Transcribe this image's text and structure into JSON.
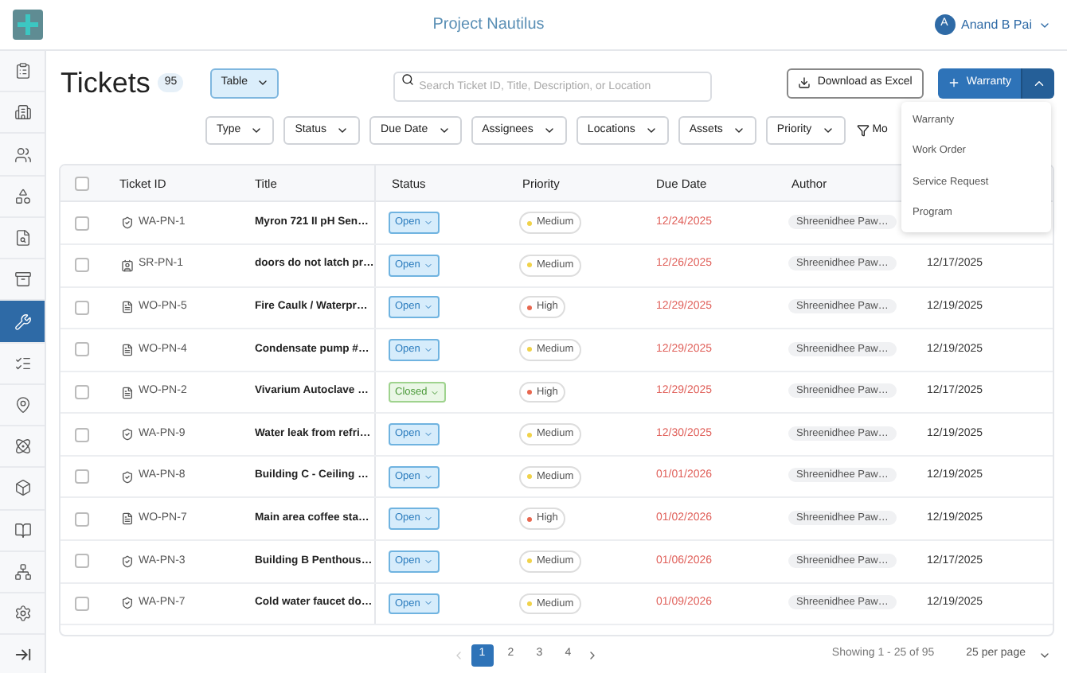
{
  "header": {
    "title": "Project Nautilus",
    "user": {
      "initial": "A",
      "name": "Anand B Pai"
    }
  },
  "sidebar": {
    "items": [
      {
        "selected": false
      },
      {
        "selected": false
      },
      {
        "selected": false
      },
      {
        "selected": false
      },
      {
        "selected": false
      },
      {
        "selected": false
      },
      {
        "selected": true
      },
      {
        "selected": false
      },
      {
        "selected": false
      },
      {
        "selected": false
      },
      {
        "selected": false
      },
      {
        "selected": false
      },
      {
        "selected": false
      },
      {
        "selected": false
      }
    ]
  },
  "page": {
    "title": "Tickets",
    "count": "95",
    "view": "Table",
    "search": {
      "placeholder": "Search Ticket ID, Title, Description, or Location"
    },
    "download": "Download as Excel",
    "create": "Warranty",
    "menu_open": true
  },
  "create_menu": [
    "Warranty",
    "Work Order",
    "Service Request",
    "Program"
  ],
  "filters": [
    "Type",
    "Status",
    "Due Date",
    "Assignees",
    "Locations",
    "Assets",
    "Priority"
  ],
  "more_filters": "Mo",
  "table": {
    "all_selected": false,
    "columns": [
      "Ticket ID",
      "Title",
      "Status",
      "Priority",
      "Due Date",
      "Author"
    ],
    "rows": [
      {
        "kind": "warranty",
        "id": "WA-PN-1",
        "title": "Myron 721 II pH Sen…",
        "status": "Open",
        "closed": false,
        "priority": "Medium",
        "color": "#f0d24a",
        "due": "12/24/2025",
        "author": "Shreenidhee Paw…",
        "checked": false
      },
      {
        "kind": "service",
        "id": "SR-PN-1",
        "title": "doors do not latch pr…",
        "status": "Open",
        "closed": false,
        "priority": "Medium",
        "color": "#f0d24a",
        "due": "12/26/2025",
        "author": "Shreenidhee Paw…",
        "created": "12/17/2025",
        "checked": false
      },
      {
        "kind": "work",
        "id": "WO-PN-5",
        "title": "Fire Caulk / Waterpr…",
        "status": "Open",
        "closed": false,
        "priority": "High",
        "color": "#e8674f",
        "due": "12/29/2025",
        "author": "Shreenidhee Paw…",
        "created": "12/19/2025",
        "checked": false
      },
      {
        "kind": "work",
        "id": "WO-PN-4",
        "title": "Condensate pump #…",
        "status": "Open",
        "closed": false,
        "priority": "Medium",
        "color": "#f0d24a",
        "due": "12/29/2025",
        "author": "Shreenidhee Paw…",
        "created": "12/19/2025",
        "checked": false
      },
      {
        "kind": "work",
        "id": "WO-PN-2",
        "title": "Vivarium Autoclave …",
        "status": "Closed",
        "closed": true,
        "priority": "High",
        "color": "#e8674f",
        "due": "12/29/2025",
        "author": "Shreenidhee Paw…",
        "created": "12/17/2025",
        "checked": false
      },
      {
        "kind": "warranty",
        "id": "WA-PN-9",
        "title": "Water leak from refri…",
        "status": "Open",
        "closed": false,
        "priority": "Medium",
        "color": "#f0d24a",
        "due": "12/30/2025",
        "author": "Shreenidhee Paw…",
        "created": "12/19/2025",
        "checked": false
      },
      {
        "kind": "warranty",
        "id": "WA-PN-8",
        "title": "Building C - Ceiling …",
        "status": "Open",
        "closed": false,
        "priority": "Medium",
        "color": "#f0d24a",
        "due": "01/01/2026",
        "author": "Shreenidhee Paw…",
        "created": "12/19/2025",
        "checked": false
      },
      {
        "kind": "work",
        "id": "WO-PN-7",
        "title": "Main area coffee sta…",
        "status": "Open",
        "closed": false,
        "priority": "High",
        "color": "#e8674f",
        "due": "01/02/2026",
        "author": "Shreenidhee Paw…",
        "created": "12/19/2025",
        "checked": false
      },
      {
        "kind": "warranty",
        "id": "WA-PN-3",
        "title": "Building B Penthous…",
        "status": "Open",
        "closed": false,
        "priority": "Medium",
        "color": "#f0d24a",
        "due": "01/06/2026",
        "author": "Shreenidhee Paw…",
        "created": "12/17/2025",
        "checked": false
      },
      {
        "kind": "warranty",
        "id": "WA-PN-7",
        "title": "Cold water faucet do…",
        "status": "Open",
        "closed": false,
        "priority": "Medium",
        "color": "#f0d24a",
        "due": "01/09/2026",
        "author": "Shreenidhee Paw…",
        "created": "12/19/2025",
        "checked": false
      }
    ]
  },
  "pagination": {
    "pages": [
      {
        "label": "1",
        "selected": true
      },
      {
        "label": "2",
        "selected": false
      },
      {
        "label": "3",
        "selected": false
      },
      {
        "label": "4",
        "selected": false
      }
    ],
    "summary": "Showing 1 - 25 of 95",
    "per_page": "25 per page"
  }
}
